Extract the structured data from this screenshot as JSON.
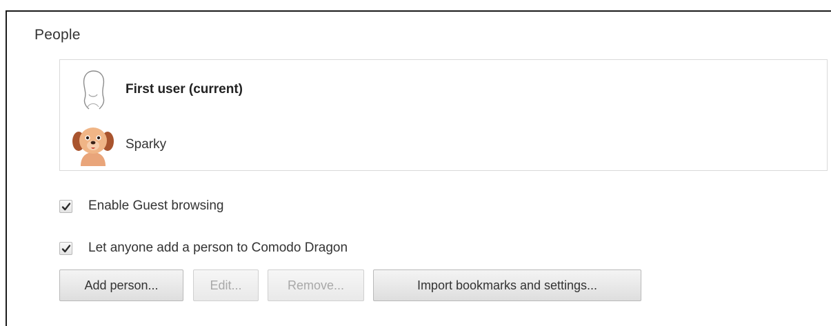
{
  "section": {
    "title": "People"
  },
  "profiles": [
    {
      "name": "First user (current)",
      "avatar_icon": "generic-person-avatar-icon",
      "current": true
    },
    {
      "name": "Sparky",
      "avatar_icon": "dog-avatar-icon",
      "current": false
    }
  ],
  "options": {
    "guest_browsing": {
      "label": "Enable Guest browsing",
      "checked": true
    },
    "add_person": {
      "label": "Let anyone add a person to Comodo Dragon",
      "checked": true
    }
  },
  "buttons": {
    "add": {
      "label": "Add person...",
      "enabled": true
    },
    "edit": {
      "label": "Edit...",
      "enabled": false
    },
    "remove": {
      "label": "Remove...",
      "enabled": false
    },
    "import": {
      "label": "Import bookmarks and settings...",
      "enabled": true
    }
  }
}
